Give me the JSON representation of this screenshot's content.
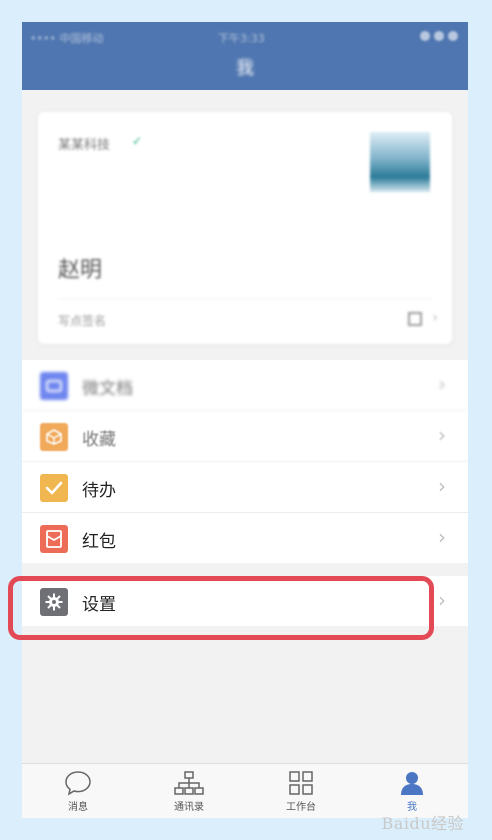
{
  "status_bar": {
    "carrier": "•••• 中国移动",
    "time": "下午3:33"
  },
  "header": {
    "title": "我"
  },
  "profile": {
    "org": "某某科技",
    "verified_mark": "✓",
    "name": "赵明",
    "signature": "写点签名",
    "chevron": "›"
  },
  "menu": [
    {
      "icon": "cloud-drive-icon",
      "label": "微文档",
      "chevron": "›"
    },
    {
      "icon": "favorites-icon",
      "label": "收藏",
      "chevron": "›"
    },
    {
      "icon": "todo-icon",
      "label": "待办",
      "chevron": "›"
    },
    {
      "icon": "red-packet-icon",
      "label": "红包",
      "chevron": "›"
    }
  ],
  "settings": {
    "icon": "gear-icon",
    "label": "设置",
    "chevron": "›"
  },
  "tabbar": {
    "tabs": [
      {
        "icon": "chat-bubble-icon",
        "label": "消息"
      },
      {
        "icon": "org-chart-icon",
        "label": "通讯录"
      },
      {
        "icon": "grid-icon",
        "label": "工作台"
      },
      {
        "icon": "person-icon",
        "label": "我"
      }
    ],
    "active": "我"
  },
  "watermark": "Baidu经验",
  "colors": {
    "header": "#4f76b0",
    "highlight": "#e34a55",
    "active_tab": "#4a76c3",
    "cloud": "#6f86ef",
    "favorites": "#f1a95a",
    "todo": "#f0b650",
    "red_packet": "#ec6c58",
    "settings": "#6e7076"
  }
}
